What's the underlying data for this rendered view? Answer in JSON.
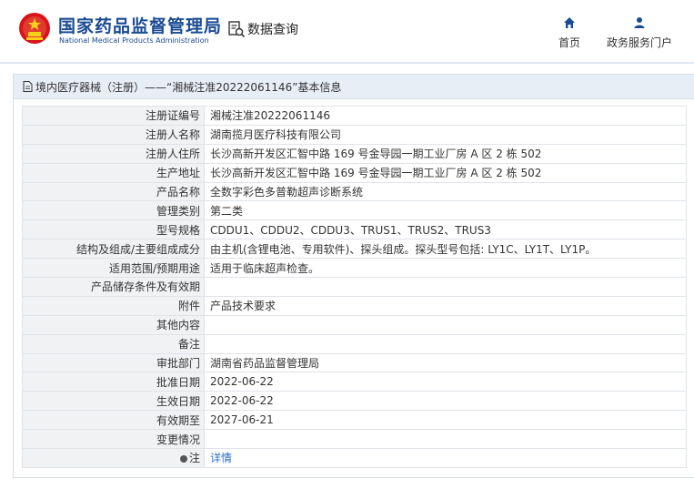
{
  "header": {
    "title_cn": "国家药品监督管理局",
    "title_en": "National Medical Products Administration",
    "query_label": "数据查询",
    "nav": [
      {
        "label": "首页",
        "icon": "home-icon"
      },
      {
        "label": "政务服务门户",
        "icon": "user-icon"
      }
    ]
  },
  "panel": {
    "breadcrumb": "境内医疗器械（注册）——“湘械注准20222061146”基本信息"
  },
  "table": {
    "rows": [
      {
        "label": "注册证编号",
        "value": "湘械注准20222061146"
      },
      {
        "label": "注册人名称",
        "value": "湖南揽月医疗科技有限公司"
      },
      {
        "label": "注册人住所",
        "value": "长沙高新开发区汇智中路 169 号金导园一期工业厂房 A 区 2 栋 502"
      },
      {
        "label": "生产地址",
        "value": "长沙高新开发区汇智中路 169 号金导园一期工业厂房 A 区 2 栋 502"
      },
      {
        "label": "产品名称",
        "value": "全数字彩色多普勒超声诊断系统"
      },
      {
        "label": "管理类别",
        "value": "第二类"
      },
      {
        "label": "型号规格",
        "value": "CDDU1、CDDU2、CDDU3、TRUS1、TRUS2、TRUS3"
      },
      {
        "label": "结构及组成/主要组成成分",
        "value": "由主机(含锂电池、专用软件)、探头组成。探头型号包括: LY1C、LY1T、LY1P。"
      },
      {
        "label": "适用范围/预期用途",
        "value": "适用于临床超声检查。"
      },
      {
        "label": "产品储存条件及有效期",
        "value": ""
      },
      {
        "label": "附件",
        "value": "产品技术要求"
      },
      {
        "label": "其他内容",
        "value": ""
      },
      {
        "label": "备注",
        "value": ""
      },
      {
        "label": "审批部门",
        "value": "湖南省药品监督管理局"
      },
      {
        "label": "批准日期",
        "value": "2022-06-22"
      },
      {
        "label": "生效日期",
        "value": "2022-06-22"
      },
      {
        "label": "有效期至",
        "value": "2027-06-21"
      },
      {
        "label": "变更情况",
        "value": ""
      }
    ],
    "note": {
      "label": "注",
      "link": "详情"
    }
  },
  "colors": {
    "brand_blue": "#1a4b93",
    "panel_header_bg": "#e7eef6",
    "label_bg": "#f1f2f4",
    "link": "#2a6fc9"
  }
}
